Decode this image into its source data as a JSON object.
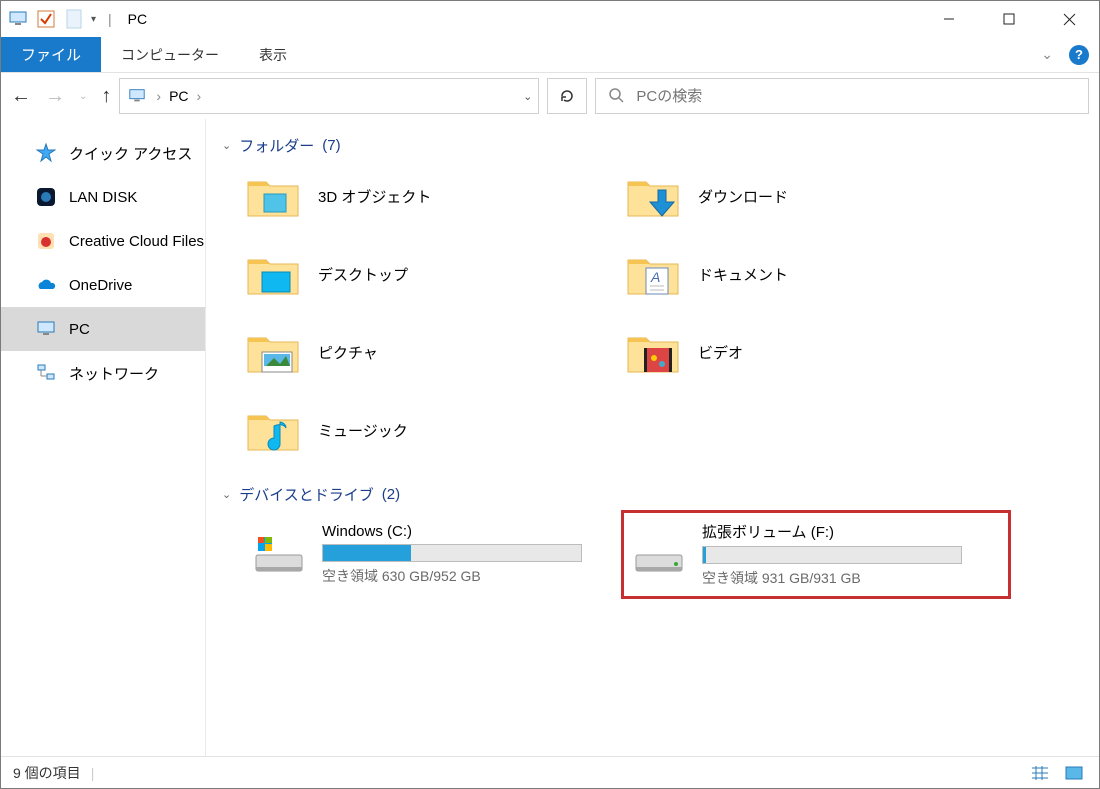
{
  "window": {
    "title": "PC"
  },
  "ribbon": {
    "file": "ファイル",
    "tabs": [
      "コンピューター",
      "表示"
    ]
  },
  "nav": {
    "back": "←",
    "forward": "→",
    "up": "↑"
  },
  "addressbar": {
    "location": "PC",
    "sep": "›"
  },
  "search": {
    "placeholder": "PCの検索"
  },
  "sidebar": {
    "items": [
      {
        "label": "クイック アクセス",
        "icon": "star"
      },
      {
        "label": "LAN DISK",
        "icon": "landisk"
      },
      {
        "label": "Creative Cloud Files",
        "icon": "cc"
      },
      {
        "label": "OneDrive",
        "icon": "onedrive"
      },
      {
        "label": "PC",
        "icon": "pc",
        "selected": true
      },
      {
        "label": "ネットワーク",
        "icon": "network"
      }
    ]
  },
  "groups": {
    "folders": {
      "title": "フォルダー",
      "count": "(7)"
    },
    "drives": {
      "title": "デバイスとドライブ",
      "count": "(2)"
    }
  },
  "folders": [
    {
      "label": "3D オブジェクト"
    },
    {
      "label": "ダウンロード"
    },
    {
      "label": "デスクトップ"
    },
    {
      "label": "ドキュメント"
    },
    {
      "label": "ピクチャ"
    },
    {
      "label": "ビデオ"
    },
    {
      "label": "ミュージック"
    }
  ],
  "drives": [
    {
      "name": "Windows (C:)",
      "free": "空き領域 630 GB/952 GB",
      "fill_pct": 34,
      "highlight": false
    },
    {
      "name": "拡張ボリューム (F:)",
      "free": "空き領域 931 GB/931 GB",
      "fill_pct": 1,
      "highlight": true
    }
  ],
  "status": {
    "items": "9 個の項目"
  }
}
